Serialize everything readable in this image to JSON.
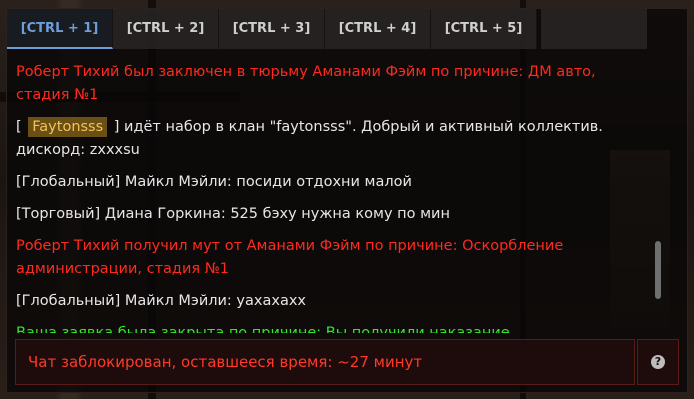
{
  "tabs": [
    {
      "label": "[CTRL + 1]"
    },
    {
      "label": "[CTRL + 2]"
    },
    {
      "label": "[CTRL + 3]"
    },
    {
      "label": "[CTRL + 4]"
    },
    {
      "label": "[CTRL + 5]"
    }
  ],
  "messages": [
    {
      "text": "Роберт Тихий был заключен в тюрьму Аманами Фэйм по причине: ДМ авто, стадия №1"
    },
    {
      "prefix": "[ ",
      "tag": "Faytonsss",
      "text": " ] идёт набор в клан \"faytonsss\". Добрый и активный коллектив. дискорд: zxxxsu"
    },
    {
      "text": "[Глобальный] Майкл Мэйли: посиди отдохни малой"
    },
    {
      "text": "[Торговый] Диана Горкина: 525 бэху нужна кому по мин"
    },
    {
      "text": "Роберт Тихий получил мут от Аманами Фэйм по причине: Оскорбление администрации, стадия №1"
    },
    {
      "text": "[Глобальный] Майкл Мэйли: уахахахх"
    },
    {
      "text": "Ваша заявка была закрыта по причине: Вы получили наказание"
    }
  ],
  "input": {
    "text": "Чат заблокирован, оставшееся время: ~27 минут"
  },
  "help": {
    "icon": "question-icon",
    "glyph": "?"
  },
  "colors": {
    "system_red": "#ff2a1e",
    "system_green": "#33e62a",
    "active_tab": "#6e9ed8",
    "clan_tag_bg": "#6b5015"
  }
}
